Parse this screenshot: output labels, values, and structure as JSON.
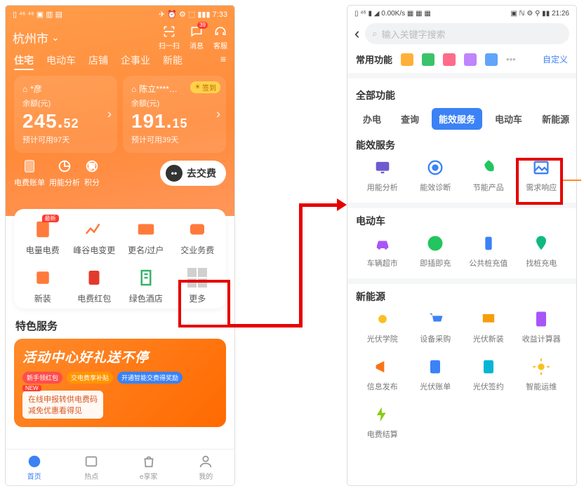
{
  "left": {
    "status": {
      "left": "▯ ⁴⁶ ⁴⁶ ▣ ▥ ▤",
      "right": "✈ ⏰ ⚙ ⬚ ▮▮▮ 7:33"
    },
    "city": "杭州市",
    "headerIcons": {
      "scan": "扫一扫",
      "msg": "消息",
      "msgBadge": "39",
      "help": "客服"
    },
    "tabs": [
      "住宅",
      "电动车",
      "店铺",
      "企事业",
      "新能"
    ],
    "cards": [
      {
        "name": "*彦",
        "balLabel": "余额(元)",
        "amount": "245.",
        "cents": "52",
        "estimate": "预计可用97天"
      },
      {
        "name": "陈立****…",
        "balLabel": "余额(元)",
        "amount": "191.",
        "cents": "15",
        "estimate": "预计可用39天",
        "signin": "签到"
      }
    ],
    "bottomRow": {
      "bill": "电费账单",
      "analysis": "用能分析",
      "points": "积分",
      "pay": "去交费"
    },
    "funcs": [
      "电量电费",
      "峰谷电变更",
      "更名/过户",
      "交业务费",
      "新装",
      "电费红包",
      "绿色酒店",
      "更多"
    ],
    "funcLatest": "最新",
    "specialTitle": "特色服务",
    "promo": {
      "title": "活动中心好礼送不停",
      "pills": [
        "新手领红包",
        "交电费享补贴",
        "开通智能交费得奖励"
      ],
      "line1": "在线申报转供电费码",
      "line2": "减免优惠看得见",
      "new": "NEW"
    },
    "tabbar": [
      "首页",
      "热点",
      "e享家",
      "我的"
    ]
  },
  "right": {
    "status": {
      "left": "▯ ⁴⁶ ▮ ◢ 0.00K/s ▦ ▦ ▦",
      "right": "▣ ℕ ⚙ ⚲ ▮▮ 21:26"
    },
    "searchPlaceholder": "输入关键字搜索",
    "common": {
      "label": "常用功能",
      "customize": "自定义"
    },
    "allLabel": "全部功能",
    "catTabs": [
      "办电",
      "查询",
      "能效服务",
      "电动车",
      "新能源"
    ],
    "sections": {
      "s1": {
        "title": "能效服务",
        "items": [
          "用能分析",
          "能效诊断",
          "节能产品",
          "需求响应"
        ]
      },
      "s2": {
        "title": "电动车",
        "items": [
          "车辆超市",
          "即插即充",
          "公共桩充值",
          "找桩充电"
        ]
      },
      "s3": {
        "title": "新能源",
        "itemsA": [
          "光伏学院",
          "设备采购",
          "光伏新装",
          "收益计算器"
        ],
        "itemsB": [
          "信息发布",
          "光伏账单",
          "光伏签约",
          "智能运维"
        ],
        "itemsC": [
          "电费结算"
        ]
      }
    }
  }
}
